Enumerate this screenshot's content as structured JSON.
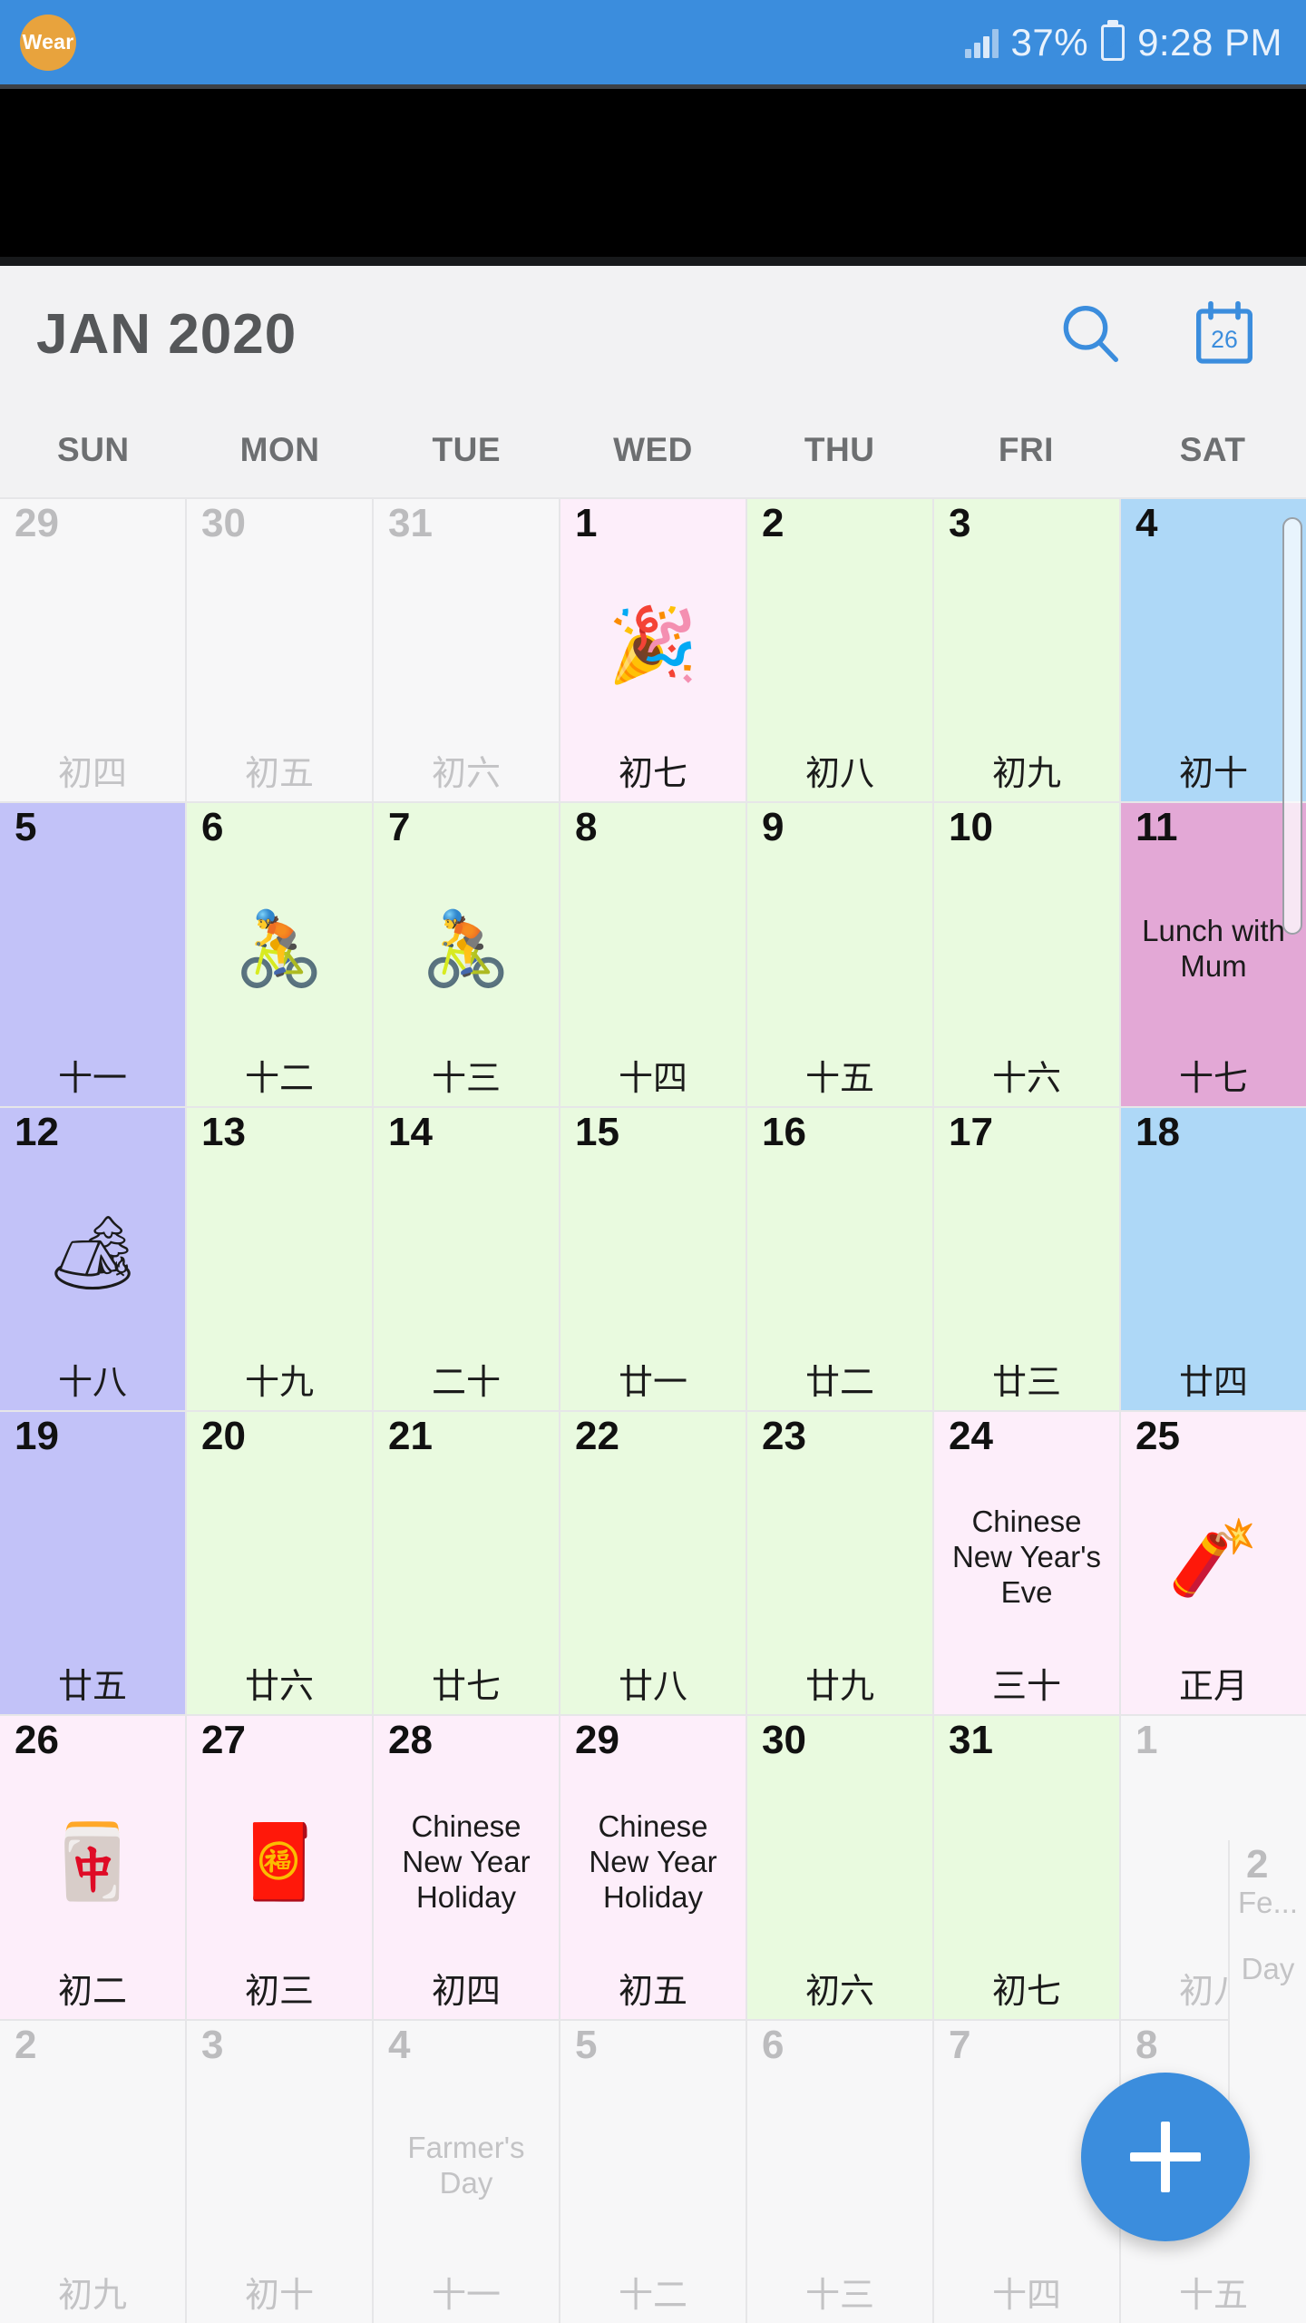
{
  "status_bar": {
    "app_badge": "Wear",
    "battery_percent": "37%",
    "time": "9:28 PM",
    "signal_icon": "signal-bars-icon",
    "battery_icon": "battery-charging-icon"
  },
  "header": {
    "title": "JAN 2020",
    "search_icon": "search-icon",
    "today_icon": "calendar-today-icon",
    "today_icon_day": "26"
  },
  "weekdays": [
    "SUN",
    "MON",
    "TUE",
    "WED",
    "THU",
    "FRI",
    "SAT"
  ],
  "fab": {
    "label": "+",
    "icon": "plus-icon"
  },
  "colors": {
    "accent": "#3b8ddd",
    "weekend_saturday": "#aed8f7",
    "weekend_sunday": "#c2c2f8",
    "weekday": "#e9fadf",
    "holiday_light": "#fdeefa",
    "event_highlight": "#e3a8d6",
    "out_of_month": "#f7f7f8",
    "badge": "#e8a33d"
  },
  "edge_column": {
    "daynum": "2",
    "event_line1": "Fe...",
    "event_line2": "Day"
  },
  "cells": [
    {
      "n": "29",
      "lunar": "初四",
      "bg": "grey",
      "dim": true,
      "event": "",
      "emoji": ""
    },
    {
      "n": "30",
      "lunar": "初五",
      "bg": "grey",
      "dim": true,
      "event": "",
      "emoji": ""
    },
    {
      "n": "31",
      "lunar": "初六",
      "bg": "grey",
      "dim": true,
      "event": "",
      "emoji": ""
    },
    {
      "n": "1",
      "lunar": "初七",
      "bg": "pinkL",
      "dim": false,
      "event": "",
      "emoji": "🎉"
    },
    {
      "n": "2",
      "lunar": "初八",
      "bg": "green",
      "dim": false,
      "event": "",
      "emoji": ""
    },
    {
      "n": "3",
      "lunar": "初九",
      "bg": "green",
      "dim": false,
      "event": "",
      "emoji": ""
    },
    {
      "n": "4",
      "lunar": "初十",
      "bg": "blue",
      "dim": false,
      "event": "",
      "emoji": ""
    },
    {
      "n": "5",
      "lunar": "十一",
      "bg": "lav",
      "dim": false,
      "event": "",
      "emoji": ""
    },
    {
      "n": "6",
      "lunar": "十二",
      "bg": "green",
      "dim": false,
      "event": "",
      "emoji": "🚴"
    },
    {
      "n": "7",
      "lunar": "十三",
      "bg": "green",
      "dim": false,
      "event": "",
      "emoji": "🚴"
    },
    {
      "n": "8",
      "lunar": "十四",
      "bg": "green",
      "dim": false,
      "event": "",
      "emoji": ""
    },
    {
      "n": "9",
      "lunar": "十五",
      "bg": "green",
      "dim": false,
      "event": "",
      "emoji": ""
    },
    {
      "n": "10",
      "lunar": "十六",
      "bg": "green",
      "dim": false,
      "event": "",
      "emoji": ""
    },
    {
      "n": "11",
      "lunar": "十七",
      "bg": "pinkD",
      "dim": false,
      "event": "Lunch with Mum",
      "emoji": ""
    },
    {
      "n": "12",
      "lunar": "十八",
      "bg": "lav",
      "dim": false,
      "event": "",
      "emoji": "🏕"
    },
    {
      "n": "13",
      "lunar": "十九",
      "bg": "green",
      "dim": false,
      "event": "",
      "emoji": ""
    },
    {
      "n": "14",
      "lunar": "二十",
      "bg": "green",
      "dim": false,
      "event": "",
      "emoji": ""
    },
    {
      "n": "15",
      "lunar": "廿一",
      "bg": "green",
      "dim": false,
      "event": "",
      "emoji": ""
    },
    {
      "n": "16",
      "lunar": "廿二",
      "bg": "green",
      "dim": false,
      "event": "",
      "emoji": ""
    },
    {
      "n": "17",
      "lunar": "廿三",
      "bg": "green",
      "dim": false,
      "event": "",
      "emoji": ""
    },
    {
      "n": "18",
      "lunar": "廿四",
      "bg": "blue",
      "dim": false,
      "event": "",
      "emoji": ""
    },
    {
      "n": "19",
      "lunar": "廿五",
      "bg": "lav",
      "dim": false,
      "event": "",
      "emoji": ""
    },
    {
      "n": "20",
      "lunar": "廿六",
      "bg": "green",
      "dim": false,
      "event": "",
      "emoji": ""
    },
    {
      "n": "21",
      "lunar": "廿七",
      "bg": "green",
      "dim": false,
      "event": "",
      "emoji": ""
    },
    {
      "n": "22",
      "lunar": "廿八",
      "bg": "green",
      "dim": false,
      "event": "",
      "emoji": ""
    },
    {
      "n": "23",
      "lunar": "廿九",
      "bg": "green",
      "dim": false,
      "event": "",
      "emoji": ""
    },
    {
      "n": "24",
      "lunar": "三十",
      "bg": "pinkL",
      "dim": false,
      "event": "Chinese New Year's Eve",
      "emoji": ""
    },
    {
      "n": "25",
      "lunar": "正月",
      "bg": "pinkL",
      "dim": false,
      "event": "",
      "emoji": "🧨"
    },
    {
      "n": "26",
      "lunar": "初二",
      "bg": "pinkL",
      "dim": false,
      "event": "",
      "emoji": "🀄"
    },
    {
      "n": "27",
      "lunar": "初三",
      "bg": "pinkL",
      "dim": false,
      "event": "",
      "emoji": "🧧"
    },
    {
      "n": "28",
      "lunar": "初四",
      "bg": "pinkL",
      "dim": false,
      "event": "Chinese New Year Holiday",
      "emoji": ""
    },
    {
      "n": "29",
      "lunar": "初五",
      "bg": "pinkL",
      "dim": false,
      "event": "Chinese New Year Holiday",
      "emoji": ""
    },
    {
      "n": "30",
      "lunar": "初六",
      "bg": "green",
      "dim": false,
      "event": "",
      "emoji": ""
    },
    {
      "n": "31",
      "lunar": "初七",
      "bg": "green",
      "dim": false,
      "event": "",
      "emoji": ""
    },
    {
      "n": "1",
      "lunar": "初八",
      "bg": "grey",
      "dim": true,
      "event": "",
      "emoji": ""
    },
    {
      "n": "2",
      "lunar": "初九",
      "bg": "grey",
      "dim": true,
      "event": "",
      "emoji": ""
    },
    {
      "n": "3",
      "lunar": "初十",
      "bg": "grey",
      "dim": true,
      "event": "",
      "emoji": ""
    },
    {
      "n": "4",
      "lunar": "十一",
      "bg": "grey",
      "dim": true,
      "event": "Farmer's Day",
      "emoji": ""
    },
    {
      "n": "5",
      "lunar": "十二",
      "bg": "grey",
      "dim": true,
      "event": "",
      "emoji": ""
    },
    {
      "n": "6",
      "lunar": "十三",
      "bg": "grey",
      "dim": true,
      "event": "",
      "emoji": ""
    },
    {
      "n": "7",
      "lunar": "十四",
      "bg": "grey",
      "dim": true,
      "event": "",
      "emoji": ""
    },
    {
      "n": "8",
      "lunar": "十五",
      "bg": "grey",
      "dim": true,
      "event": "",
      "emoji": ""
    }
  ]
}
